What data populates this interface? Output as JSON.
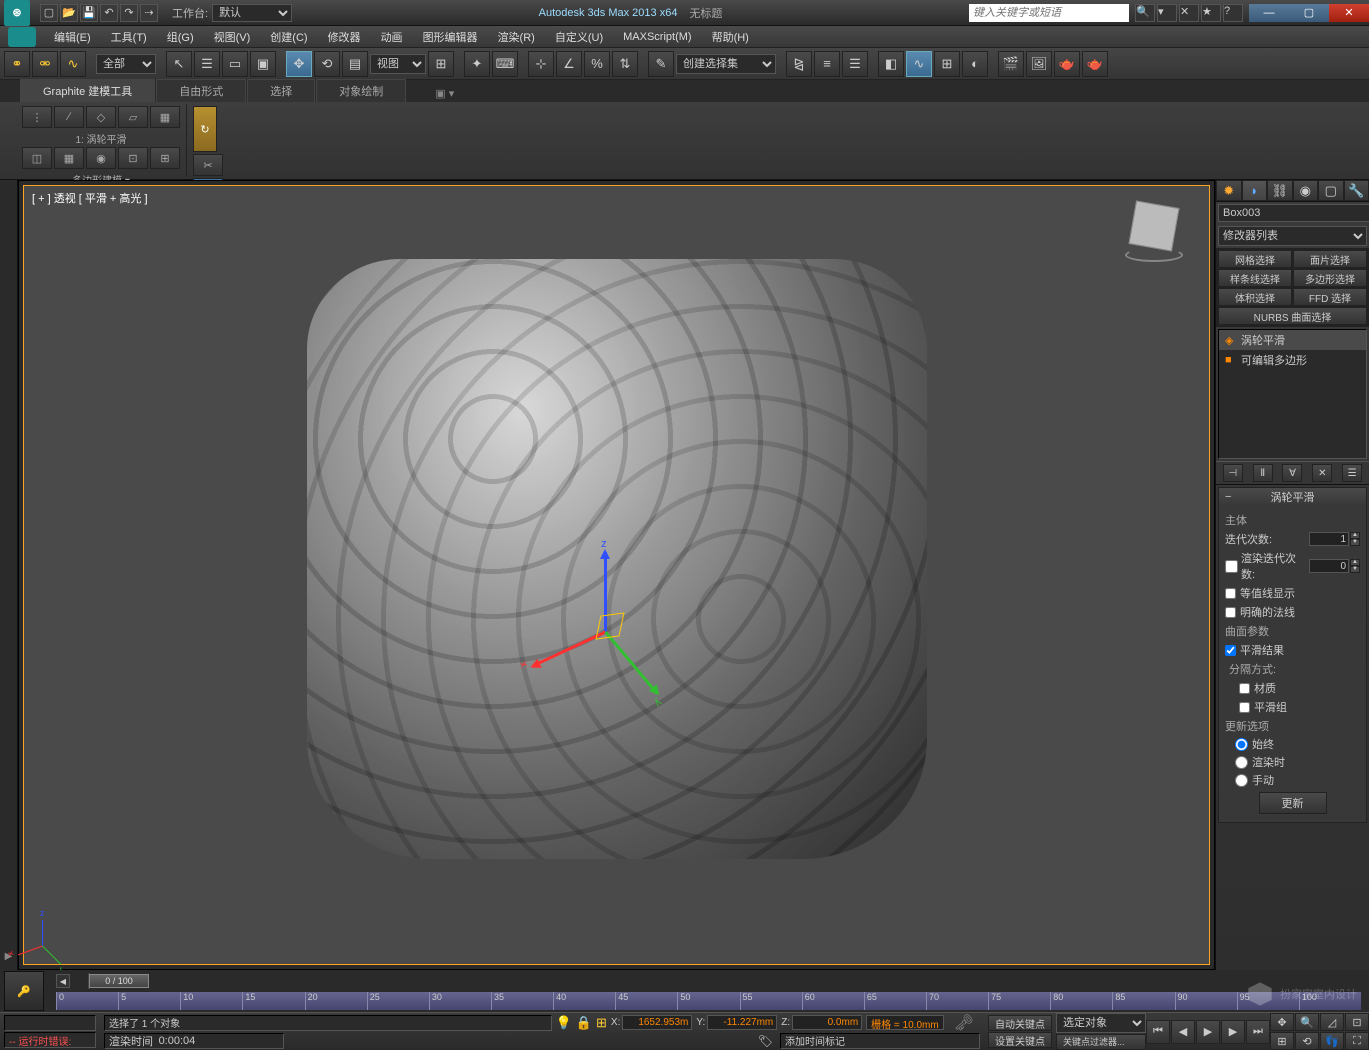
{
  "title": {
    "app": "Autodesk 3ds Max  2013 x64",
    "doc": "无标题",
    "workspace_label": "工作台:",
    "workspace_value": "默认",
    "search_placeholder": "键入关键字或短语"
  },
  "menu": [
    "编辑(E)",
    "工具(T)",
    "组(G)",
    "视图(V)",
    "创建(C)",
    "修改器",
    "动画",
    "图形编辑器",
    "渲染(R)",
    "自定义(U)",
    "MAXScript(M)",
    "帮助(H)"
  ],
  "toolbar": {
    "filter": "全部",
    "ref_coord": "视图",
    "named_sel": "创建选择集"
  },
  "ribbon": {
    "tabs": [
      "Graphite 建模工具",
      "自由形式",
      "选择",
      "对象绘制"
    ],
    "active": 0,
    "mode": "多边形建模 ▾",
    "preset": "1: 涡轮平滑"
  },
  "viewport": {
    "label": "[ + ] 透视 [ 平滑 + 高光 ]"
  },
  "cmd": {
    "object_name": "Box003",
    "mod_dropdown": "修改器列表",
    "sel_buttons": [
      "网格选择",
      "面片选择",
      "样条线选择",
      "多边形选择",
      "体积选择",
      "FFD 选择",
      "NURBS 曲面选择"
    ],
    "stack": [
      {
        "name": "涡轮平滑",
        "eye": "◈"
      },
      {
        "name": "可编辑多边形",
        "eye": "■"
      }
    ],
    "rollout_title": "涡轮平滑",
    "main_group": "主体",
    "iterations_label": "迭代次数:",
    "iterations": "1",
    "render_iters_label": "渲染迭代次数:",
    "render_iters": "0",
    "isoline": "等值线显示",
    "explicit": "明确的法线",
    "surface_group": "曲面参数",
    "smooth_result": "平滑结果",
    "separate": "分隔方式:",
    "by_mat": "材质",
    "by_smooth": "平滑组",
    "update_group": "更新选项",
    "always": "始终",
    "render": "渲染时",
    "manual": "手动",
    "update_btn": "更新"
  },
  "timeline": {
    "pos": "0 / 100",
    "ticks": [
      "0",
      "5",
      "10",
      "15",
      "20",
      "25",
      "30",
      "35",
      "40",
      "45",
      "50",
      "55",
      "60",
      "65",
      "70",
      "75",
      "80",
      "85",
      "90",
      "95",
      "100"
    ]
  },
  "status": {
    "runtime_error": "-- 运行时错误:",
    "selected": "选择了 1 个对象",
    "render_time_label": "渲染时间",
    "render_time": "0:00:04",
    "x": "1652.953m",
    "y": "-11.227mm",
    "z": "0.0mm",
    "grid": "栅格 = 10.0mm",
    "add_time_tag": "添加时间标记",
    "auto_key": "自动关键点",
    "set_key": "设置关键点",
    "sel_filter": "选定对象",
    "key_filter": "关键点过滤器..."
  },
  "watermark": "扮家家室内设计"
}
